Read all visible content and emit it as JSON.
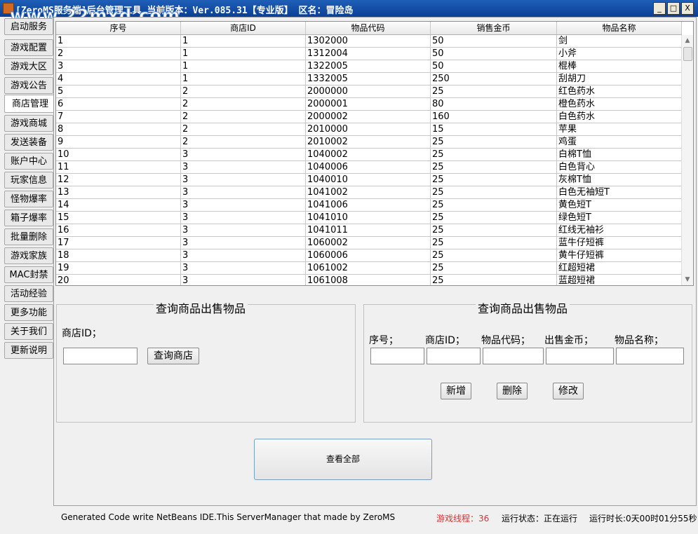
{
  "window": {
    "title": "[ZeroMS服务端]后台管理工具 当前版本：Ver.085.31【专业版】 区名：冒险岛",
    "watermark": "www.22mxd.com",
    "min_label": "_",
    "max_label": "□",
    "close_label": "X"
  },
  "sidebar": {
    "items": [
      {
        "label": "启动服务"
      },
      {
        "label": "游戏配置"
      },
      {
        "label": "游戏大区"
      },
      {
        "label": "游戏公告"
      },
      {
        "label": "商店管理",
        "active": true
      },
      {
        "label": "游戏商城"
      },
      {
        "label": "发送装备"
      },
      {
        "label": "账户中心"
      },
      {
        "label": "玩家信息"
      },
      {
        "label": "怪物爆率"
      },
      {
        "label": "箱子爆率"
      },
      {
        "label": "批量删除"
      },
      {
        "label": "游戏家族"
      },
      {
        "label": "MAC封禁"
      },
      {
        "label": "活动经验"
      },
      {
        "label": "更多功能"
      },
      {
        "label": "关于我们"
      },
      {
        "label": "更新说明"
      }
    ]
  },
  "table": {
    "columns": [
      "序号",
      "商店ID",
      "物品代码",
      "销售金币",
      "物品名称"
    ],
    "rows": [
      [
        "1",
        "1",
        "1302000",
        "50",
        "剑"
      ],
      [
        "2",
        "1",
        "1312004",
        "50",
        "小斧"
      ],
      [
        "3",
        "1",
        "1322005",
        "50",
        "棍棒"
      ],
      [
        "4",
        "1",
        "1332005",
        "250",
        "刮胡刀"
      ],
      [
        "5",
        "2",
        "2000000",
        "25",
        "红色药水"
      ],
      [
        "6",
        "2",
        "2000001",
        "80",
        "橙色药水"
      ],
      [
        "7",
        "2",
        "2000002",
        "160",
        "白色药水"
      ],
      [
        "8",
        "2",
        "2010000",
        "15",
        "苹果"
      ],
      [
        "9",
        "2",
        "2010002",
        "25",
        "鸡蛋"
      ],
      [
        "10",
        "3",
        "1040002",
        "25",
        "白棉T恤"
      ],
      [
        "11",
        "3",
        "1040006",
        "25",
        "白色背心"
      ],
      [
        "12",
        "3",
        "1040010",
        "25",
        "灰棉T恤"
      ],
      [
        "13",
        "3",
        "1041002",
        "25",
        "白色无袖短T"
      ],
      [
        "14",
        "3",
        "1041006",
        "25",
        "黄色短T"
      ],
      [
        "15",
        "3",
        "1041010",
        "25",
        "绿色短T"
      ],
      [
        "16",
        "3",
        "1041011",
        "25",
        "红线无袖衫"
      ],
      [
        "17",
        "3",
        "1060002",
        "25",
        "蓝牛仔短裤"
      ],
      [
        "18",
        "3",
        "1060006",
        "25",
        "黄牛仔短裤"
      ],
      [
        "19",
        "3",
        "1061002",
        "25",
        "红超短裙"
      ],
      [
        "20",
        "3",
        "1061008",
        "25",
        "蓝超短裙"
      ]
    ]
  },
  "query_panel": {
    "title": "查询商品出售物品",
    "shop_id_label": "商店ID；",
    "shop_id_value": "",
    "query_button": "查询商店"
  },
  "edit_panel": {
    "title": "查询商品出售物品",
    "labels": [
      "序号；",
      "商店ID；",
      "物品代码；",
      "出售金币；",
      "物品名称；"
    ],
    "add_button": "新增",
    "delete_button": "删除",
    "modify_button": "修改"
  },
  "view_all_button": "查看全部",
  "statusbar": {
    "generated": "Generated Code write NetBeans IDE.This ServerManager that made by ZeroMS",
    "threads": "游戏线程：36",
    "run_state": "运行状态：正在运行",
    "run_time": "运行时长:0天00时01分55秒",
    "threads_color": "#e03030"
  }
}
